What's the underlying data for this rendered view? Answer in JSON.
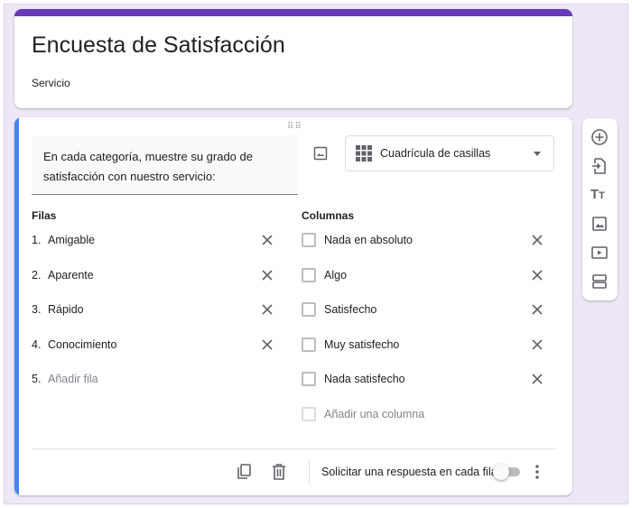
{
  "form": {
    "title": "Encuesta de Satisfacción",
    "description": "Servicio"
  },
  "question": {
    "text": "En cada categoría, muestre su grado de satisfacción con nuestro servicio:",
    "type": "Cuadrícula de casillas",
    "rows_header": "Filas",
    "columns_header": "Columnas",
    "rows": [
      {
        "num": "1.",
        "label": "Amigable"
      },
      {
        "num": "2.",
        "label": "Aparente"
      },
      {
        "num": "3.",
        "label": "Rápido"
      },
      {
        "num": "4.",
        "label": "Conocimiento"
      }
    ],
    "add_row": {
      "num": "5.",
      "label": "Añadir fila"
    },
    "columns": [
      "Nada en absoluto",
      "Algo",
      "Satisfecho",
      "Muy satisfecho",
      "Nada satisfecho"
    ],
    "add_column": "Añadir una columna",
    "require_label": "Solicitar una respuesta en cada fila",
    "require_on": false
  },
  "colors": {
    "header": "#673ab7",
    "accent": "#4285f4",
    "background": "#ede7f6"
  }
}
